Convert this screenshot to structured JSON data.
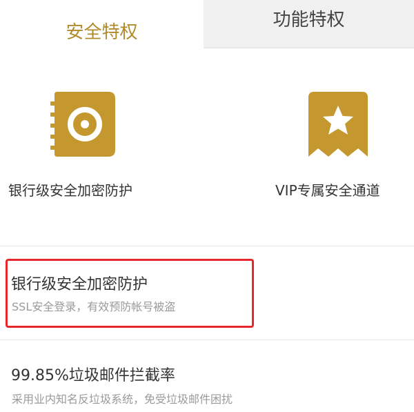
{
  "tabs": {
    "active_label": "安全特权",
    "inactive_label": "功能特权"
  },
  "features": [
    {
      "icon": "lock-book-icon",
      "label": "银行级安全加密防护"
    },
    {
      "icon": "vip-star-ribbon-icon",
      "label": "VIP专属安全通道"
    }
  ],
  "items": [
    {
      "title": "银行级安全加密防护",
      "subtitle": "SSL安全登录，有效预防帐号被盗",
      "highlighted": true
    },
    {
      "title": "99.85%垃圾邮件拦截率",
      "subtitle": "采用业内知名反垃圾系统，免受垃圾邮件困扰",
      "highlighted": false
    }
  ],
  "colors": {
    "accent_gold": "#b18a2a",
    "icon_gold": "#c4972f",
    "highlight_red": "#e8272b",
    "inactive_tab_bg": "#f0f0f0"
  }
}
